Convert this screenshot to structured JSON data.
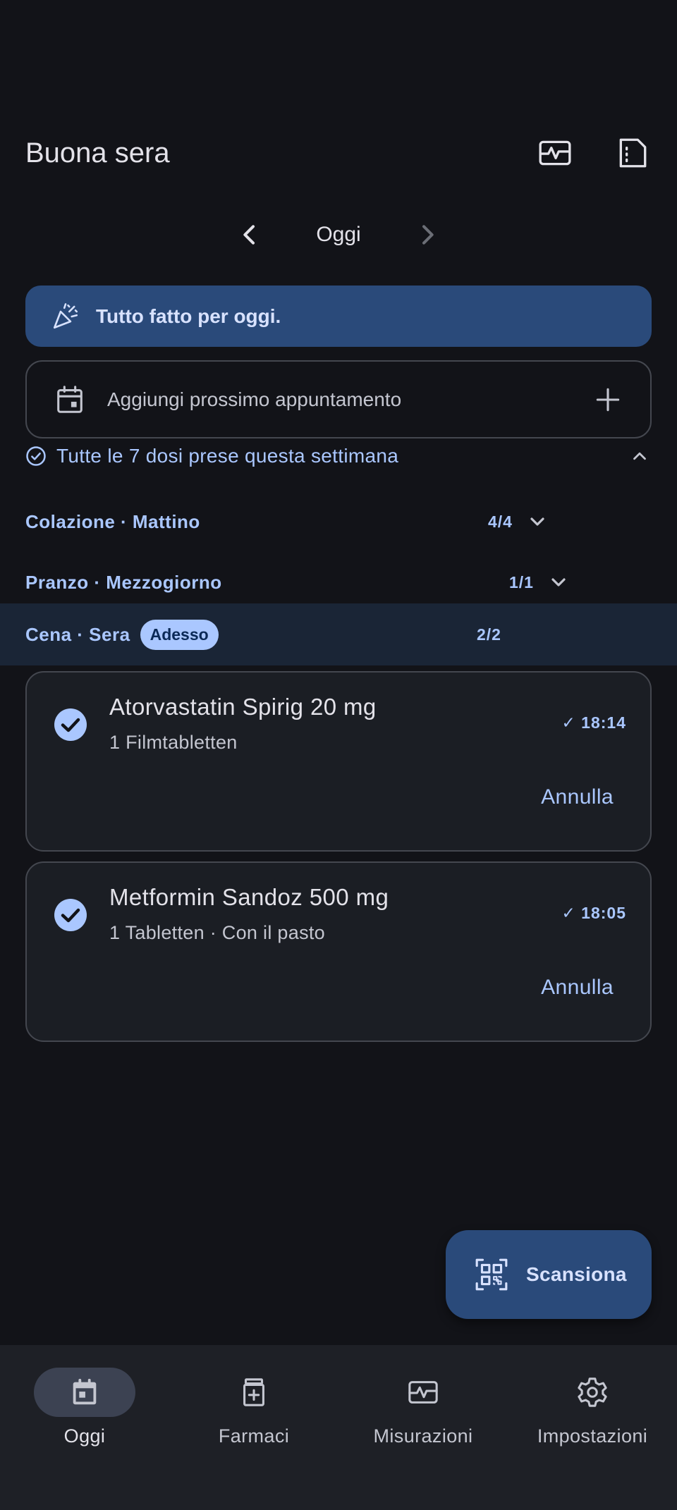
{
  "header": {
    "greeting": "Buona sera",
    "actions": [
      "measurements-icon",
      "report-icon"
    ]
  },
  "date_nav": {
    "label": "Oggi"
  },
  "banner": {
    "text": "Tutto fatto per oggi.",
    "icon": "party-popper-icon"
  },
  "appointment": {
    "placeholder": "Aggiungi prossimo appuntamento",
    "icon": "calendar-icon"
  },
  "week_summary": {
    "text": "Tutte le 7 dosi prese questa settimana"
  },
  "sections": [
    {
      "title": "Colazione · Mattino",
      "count": "4/4",
      "expanded": false
    },
    {
      "title": "Pranzo · Mezzogiorno",
      "count": "1/1",
      "expanded": false
    },
    {
      "title": "Cena · Sera",
      "badge": "Adesso",
      "count": "2/2",
      "expanded": true
    }
  ],
  "meds": [
    {
      "name": "Atorvastatin Spirig 20 mg",
      "dose": "1 Filmtabletten",
      "time": "✓ 18:14",
      "undo": "Annulla"
    },
    {
      "name": "Metformin Sandoz 500 mg",
      "dose": "1 Tabletten · Con il pasto",
      "time": "✓ 18:05",
      "undo": "Annulla"
    }
  ],
  "fab": {
    "label": "Scansiona",
    "icon": "qr-scan-icon"
  },
  "bottom_nav": [
    {
      "label": "Oggi",
      "icon": "calendar-today-icon",
      "active": true
    },
    {
      "label": "Farmaci",
      "icon": "medication-icon",
      "active": false
    },
    {
      "label": "Misurazioni",
      "icon": "measurements-icon",
      "active": false
    },
    {
      "label": "Impostazioni",
      "icon": "gear-icon",
      "active": false
    }
  ],
  "colors": {
    "background": "#121318",
    "accent": "#aac7ff",
    "banner": "#2a4a7a",
    "card": "#1b1e24"
  }
}
